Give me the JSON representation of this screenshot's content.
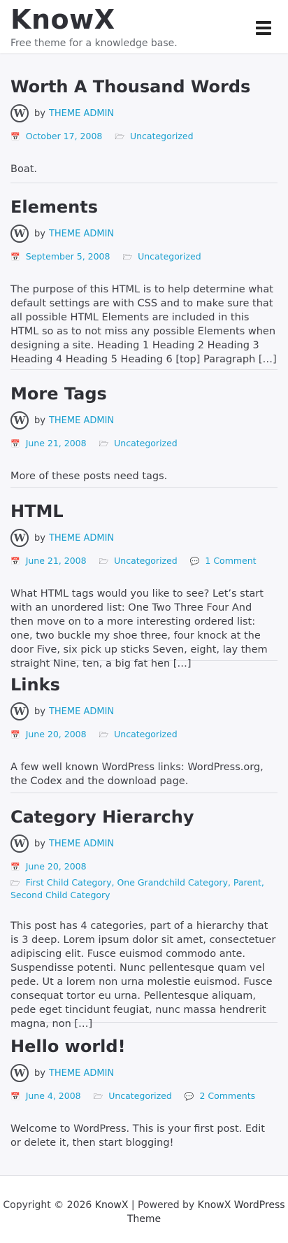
{
  "site": {
    "title": "KnowX",
    "tagline": "Free theme for a knowledge base."
  },
  "author_label": "by",
  "posts": [
    {
      "title": "Worth A Thousand Words",
      "author": "THEME ADMIN",
      "date": "October 17, 2008",
      "categories": "Uncategorized",
      "comments": "",
      "excerpt": "Boat."
    },
    {
      "title": "Elements",
      "author": "THEME ADMIN",
      "date": "September 5, 2008",
      "categories": "Uncategorized",
      "comments": "",
      "excerpt": "The purpose of this HTML is to help determine what default settings are with CSS and to make sure that all possible HTML Elements are included in this HTML so as to not miss any possible Elements when designing a site. Heading 1 Heading 2 Heading 3 Heading 4 Heading 5 Heading 6 [top] Paragraph […]"
    },
    {
      "title": "More Tags",
      "author": "THEME ADMIN",
      "date": "June 21, 2008",
      "categories": "Uncategorized",
      "comments": "",
      "excerpt": "More of these posts need tags."
    },
    {
      "title": "HTML",
      "author": "THEME ADMIN",
      "date": "June 21, 2008",
      "categories": "Uncategorized",
      "comments": "1 Comment",
      "excerpt": "What HTML tags would you like to see? Let’s start with an unordered list: One Two Three Four And then move on to a more interesting ordered list: one, two buckle my shoe three, four knock at the door Five, six pick up sticks Seven, eight, lay them straight Nine, ten, a big fat hen […]"
    },
    {
      "title": "Links",
      "author": "THEME ADMIN",
      "date": "June 20, 2008",
      "categories": "Uncategorized",
      "comments": "",
      "excerpt": "A few well known WordPress links: WordPress.org, the Codex and the download page."
    },
    {
      "title": "Category Hierarchy",
      "author": "THEME ADMIN",
      "date": "June 20, 2008",
      "categories": "First Child Category, One Grandchild Category, Parent, Second Child Category",
      "comments": "",
      "excerpt": "This post has 4 categories, part of a hierarchy that is 3 deep. Lorem ipsum dolor sit amet, consectetuer adipiscing elit. Fusce euismod commodo ante. Suspendisse potenti. Nunc pellentesque quam vel pede. Ut a lorem non urna molestie euismod. Fusce consequat tortor eu urna. Pellentesque aliquam, pede eget tincidunt feugiat, nunc massa hendrerit magna, non […]"
    },
    {
      "title": "Hello world!",
      "author": "THEME ADMIN",
      "date": "June 4, 2008",
      "categories": "Uncategorized",
      "comments": "2 Comments",
      "excerpt": "Welcome to WordPress. This is your first post. Edit or delete it, then start blogging!"
    }
  ],
  "footer": {
    "copyright": "Copyright © 2026",
    "site_link": "KnowX",
    "separator": "| Powered by",
    "theme_link": "KnowX WordPress Theme"
  },
  "icons": {
    "menu": "hamburger-icon",
    "avatar": "wordpress-logo-icon",
    "date": "calendar-icon",
    "category": "folder-open-icon",
    "comment": "comment-icon"
  },
  "colors": {
    "accent": "#1a9fcf",
    "text": "#3f4046",
    "background": "#f7f7fa"
  }
}
